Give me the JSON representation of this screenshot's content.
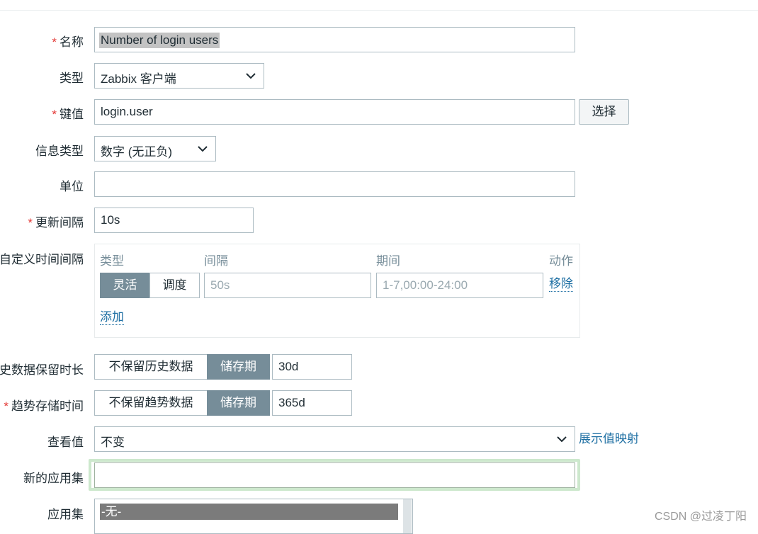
{
  "form": {
    "name": {
      "label": "名称",
      "value": "Number of login users"
    },
    "type": {
      "label": "类型",
      "value": "Zabbix 客户端"
    },
    "key": {
      "label": "键值",
      "value": "login.user",
      "select_button": "选择"
    },
    "info_type": {
      "label": "信息类型",
      "value": "数字 (无正负)"
    },
    "units": {
      "label": "单位",
      "value": ""
    },
    "update_interval": {
      "label": "更新间隔",
      "value": "10s"
    },
    "custom_intervals": {
      "label": "自定义时间间隔",
      "headers": {
        "type": "类型",
        "interval": "间隔",
        "period": "期间",
        "action": "动作"
      },
      "row": {
        "flexible": "灵活",
        "scheduling": "调度",
        "interval_placeholder": "50s",
        "period_placeholder": "1-7,00:00-24:00",
        "remove": "移除"
      },
      "add": "添加"
    },
    "history": {
      "label": "历史数据保留时长",
      "no_keep": "不保留历史数据",
      "storage": "储存期",
      "value": "30d"
    },
    "trends": {
      "label": "趋势存储时间",
      "no_keep": "不保留趋势数据",
      "storage": "储存期",
      "value": "365d"
    },
    "show_value": {
      "label": "查看值",
      "value": "不变",
      "link": "展示值映射"
    },
    "new_application": {
      "label": "新的应用集",
      "value": ""
    },
    "applications": {
      "label": "应用集",
      "selected": "-无-"
    }
  },
  "watermark": "CSDN @过凌丁阳",
  "colors": {
    "accent": "#768d99",
    "required": "#e33734",
    "link": "#1e6fa3",
    "focus": "#cde8cd"
  }
}
